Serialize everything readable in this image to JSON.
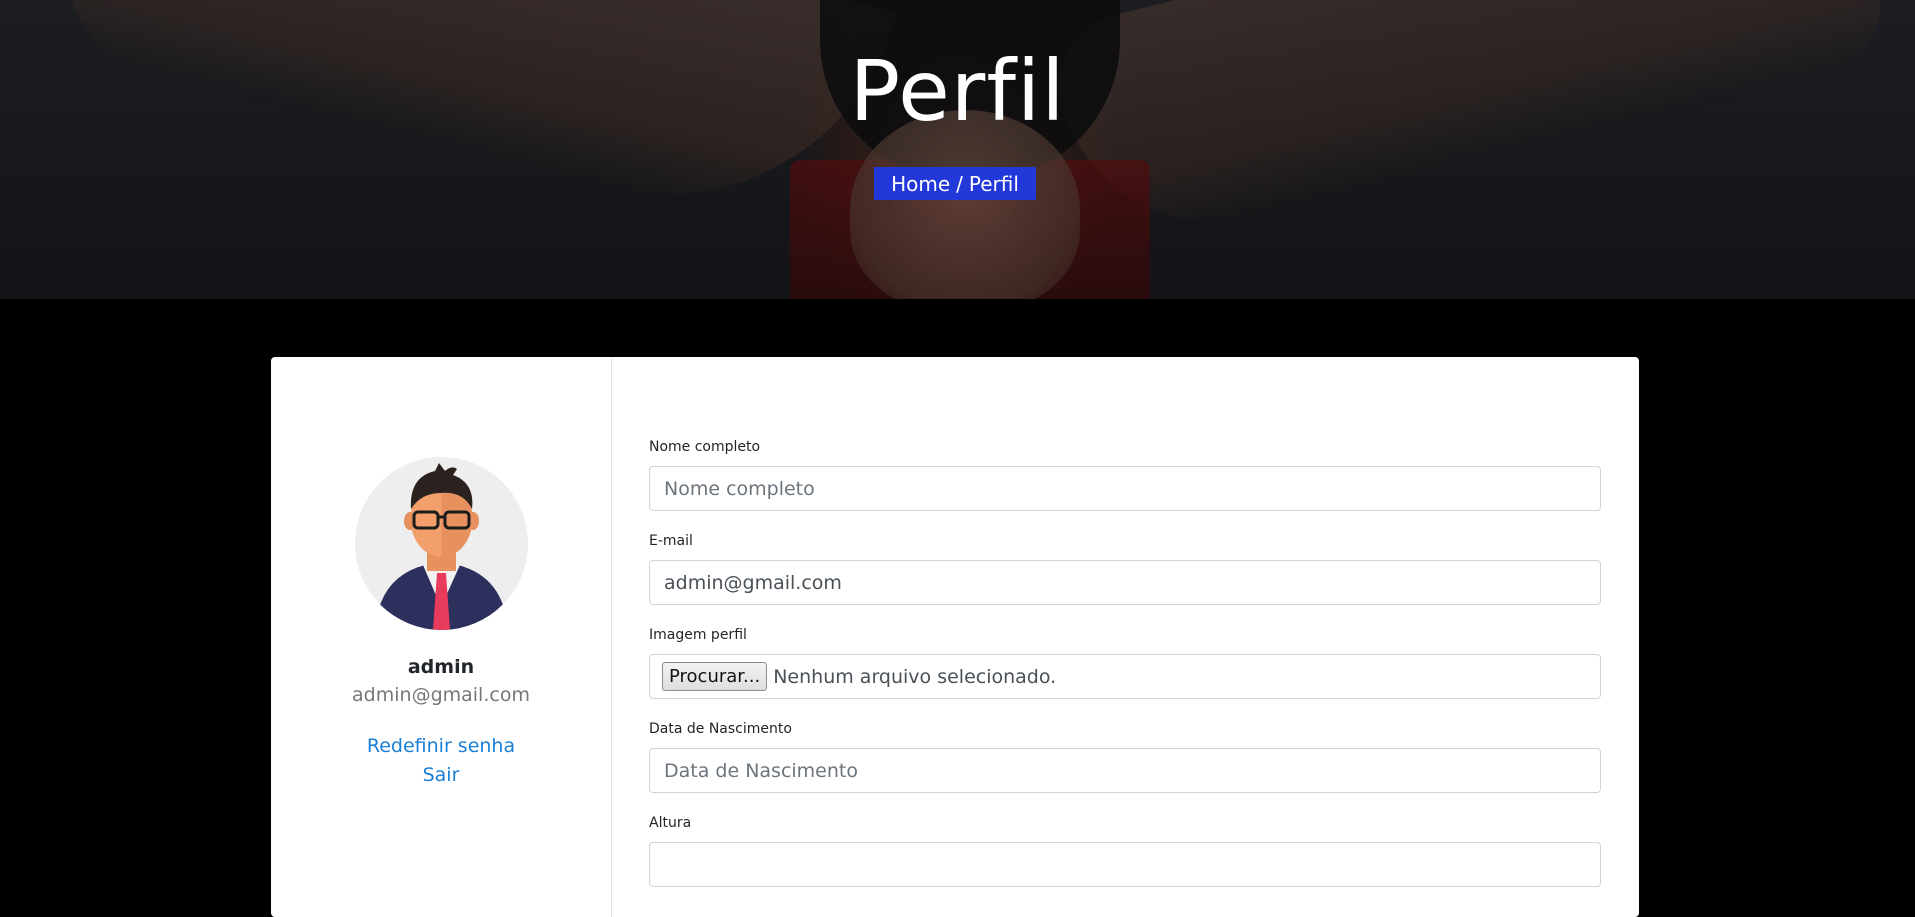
{
  "hero": {
    "title": "Perfil",
    "breadcrumb_home": "Home",
    "breadcrumb_separator": "/",
    "breadcrumb_current": "Perfil"
  },
  "profile": {
    "username": "admin",
    "email": "admin@gmail.com",
    "reset_password": "Redefinir senha",
    "logout": "Sair"
  },
  "form": {
    "full_name": {
      "label": "Nome completo",
      "placeholder": "Nome completo",
      "value": ""
    },
    "email": {
      "label": "E-mail",
      "value": "admin@gmail.com"
    },
    "image": {
      "label": "Imagem perfil",
      "button": "Procurar...",
      "status": "Nenhum arquivo selecionado."
    },
    "birth_date": {
      "label": "Data de Nascimento",
      "placeholder": "Data de Nascimento"
    },
    "height": {
      "label": "Altura"
    }
  },
  "colors": {
    "breadcrumb_bg": "#2338d8",
    "link": "#1a7fd6"
  }
}
